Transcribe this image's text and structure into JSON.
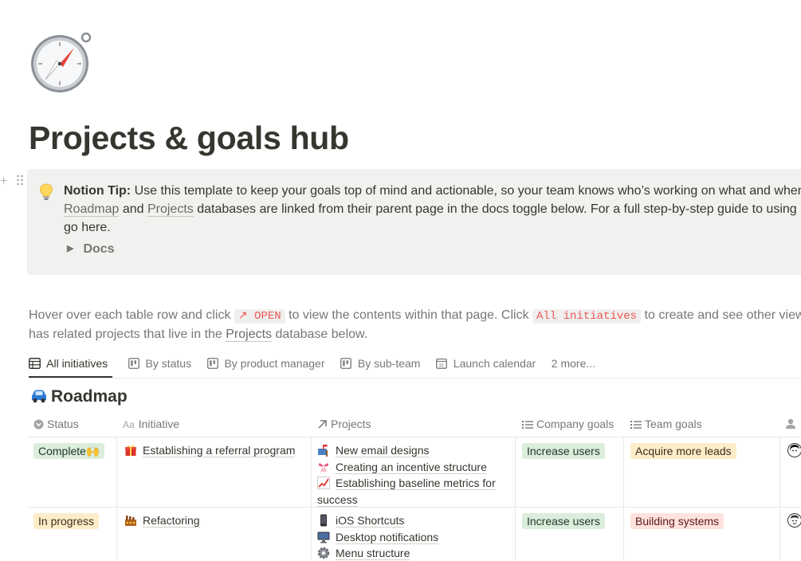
{
  "page": {
    "title": "Projects & goals hub",
    "icon": "compass-icon"
  },
  "callout": {
    "icon": "lightbulb-icon",
    "tip_label": "Notion Tip:",
    "line1_text": " Use this template to keep your goals top of mind and actionable, so your team knows who’s working on what and when",
    "link_roadmap": "Roadmap",
    "and_text": " and ",
    "link_projects": "Projects",
    "line2_text": " databases are linked from their parent page in the docs toggle below. For a full step-by-step guide to using",
    "line3_text": "go here.",
    "toggle_label": "Docs"
  },
  "description": {
    "part1": "Hover over each table row and click ",
    "open_code": "↗ OPEN",
    "part2": " to view the contents within that page. Click ",
    "initiatives_code": "All initiatives",
    "part3": " to create and see other views",
    "line2_part1": "has related projects that live in the ",
    "line2_link": "Projects",
    "line2_part2": " database below."
  },
  "tabs": [
    {
      "label": "All initiatives",
      "icon": "table-icon",
      "active": true
    },
    {
      "label": "By status",
      "icon": "board-icon",
      "active": false
    },
    {
      "label": "By product manager",
      "icon": "board-icon",
      "active": false
    },
    {
      "label": "By sub-team",
      "icon": "board-icon",
      "active": false
    },
    {
      "label": "Launch calendar",
      "icon": "calendar-icon",
      "active": false
    }
  ],
  "tabs_more": "2 more...",
  "database": {
    "icon": "car-icon",
    "title": "Roadmap",
    "columns": [
      {
        "label": "Status",
        "icon": "status-icon"
      },
      {
        "label": "Initiative",
        "icon": "title-icon"
      },
      {
        "label": "Projects",
        "icon": "relation-arrow-icon"
      },
      {
        "label": "Company goals",
        "icon": "multiselect-icon"
      },
      {
        "label": "Team goals",
        "icon": "multiselect-icon"
      },
      {
        "label": "",
        "icon": "person-icon"
      }
    ],
    "rows": [
      {
        "status": "Complete🙌",
        "status_color": "#dbeddb",
        "initiative": "Establishing a referral program",
        "initiative_icon": "gift-icon",
        "projects": [
          {
            "icon": "mailbox-icon",
            "label": "New email designs"
          },
          {
            "icon": "ribbon-icon",
            "label": "Creating an incentive structure"
          },
          {
            "icon": "chart-up-icon",
            "label": "Establishing baseline metrics for",
            "label_cont": "success"
          }
        ],
        "company_goal": "Increase users",
        "team_goal": "Acquire more leads",
        "team_goal_color": "#fdecc8"
      },
      {
        "status": "In progress",
        "status_color": "#fdecc8",
        "initiative": "Refactoring",
        "initiative_icon": "factory-icon",
        "projects": [
          {
            "icon": "phone-icon",
            "label": "iOS Shortcuts"
          },
          {
            "icon": "desktop-icon",
            "label": "Desktop notifications"
          },
          {
            "icon": "gear-icon",
            "label": "Menu structure"
          }
        ],
        "company_goal": "Increase users",
        "team_goal": "Building systems",
        "team_goal_color": "#ffe2dd"
      }
    ]
  }
}
